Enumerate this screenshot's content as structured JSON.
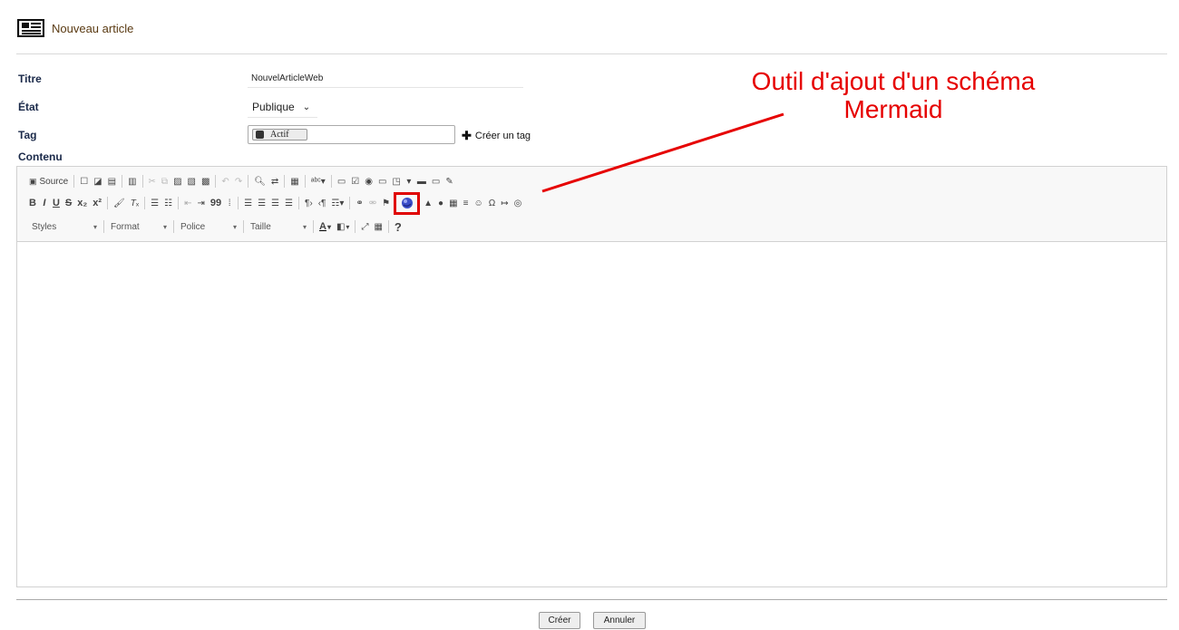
{
  "header": {
    "title": "Nouveau article",
    "icon": "newspaper-icon"
  },
  "form": {
    "titre_label": "Titre",
    "titre_value": "NouvelArticleWeb",
    "etat_label": "État",
    "etat_value": "Publique",
    "tag_label": "Tag",
    "tag_chip": "Actif",
    "create_tag": "Créer un tag",
    "contenu_label": "Contenu"
  },
  "toolbar": {
    "source": "Source",
    "bold": "B",
    "italic": "I",
    "underline": "U",
    "strike": "S",
    "subscript": "x₂",
    "superscript": "x²",
    "blockquote": "99",
    "help": "?",
    "text_color": "A",
    "styles": "Styles",
    "format": "Format",
    "police": "Police",
    "taille": "Taille"
  },
  "annotation": {
    "line1": "Outil d'ajout d'un schéma",
    "line2": "Mermaid",
    "color": "#e60000"
  },
  "buttons": {
    "creer": "Créer",
    "annuler": "Annuler"
  }
}
